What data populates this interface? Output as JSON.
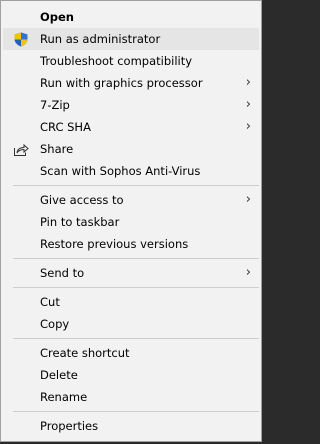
{
  "menu": {
    "open": "Open",
    "run_as_admin": "Run as administrator",
    "troubleshoot": "Troubleshoot compatibility",
    "run_with_gpu": "Run with graphics processor",
    "zip": "7-Zip",
    "crc_sha": "CRC SHA",
    "share": "Share",
    "scan_sophos": "Scan with Sophos Anti-Virus",
    "give_access": "Give access to",
    "pin_taskbar": "Pin to taskbar",
    "restore_versions": "Restore previous versions",
    "send_to": "Send to",
    "cut": "Cut",
    "copy": "Copy",
    "create_shortcut": "Create shortcut",
    "delete": "Delete",
    "rename": "Rename",
    "properties": "Properties"
  },
  "icons": {
    "shield": "uac-shield-icon",
    "share": "share-icon",
    "submenu": "chevron-right-icon"
  },
  "colors": {
    "menu_bg": "#f2f2f2",
    "highlight": "#e5e5e5",
    "separator": "#cdcdcd",
    "shield_blue": "#1f5fbf",
    "shield_yellow": "#f5c400"
  }
}
